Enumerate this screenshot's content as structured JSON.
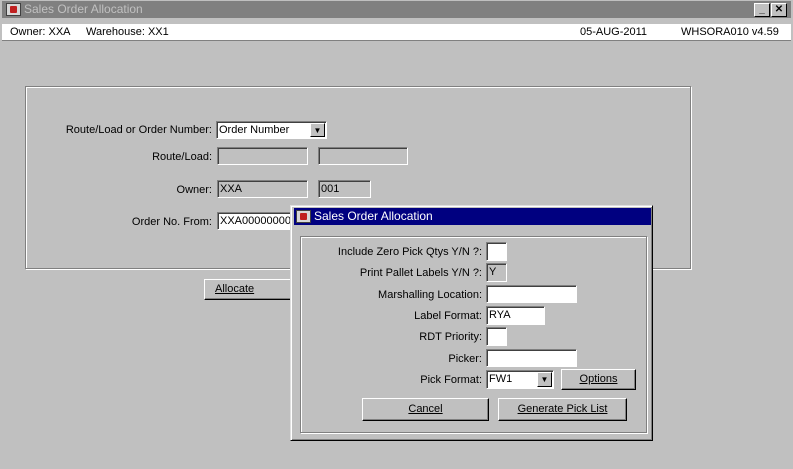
{
  "main_window": {
    "title": "Sales Order Allocation",
    "status": {
      "owner": "Owner:  XXA",
      "warehouse": "Warehouse:  XX1",
      "date": "05-AUG-2011",
      "program": "WHSORA010  v4.59"
    },
    "form": {
      "route_or_order_label": "Route/Load or Order Number:",
      "route_or_order_value": "Order Number",
      "route_load_label": "Route/Load:",
      "route_load_value1": "",
      "route_load_value2": "",
      "owner_label": "Owner:",
      "owner_value": "XXA",
      "owner_code": "001",
      "order_from_label": "Order No. From:",
      "order_from_value": "XXA00000000"
    },
    "allocate_button": "Allocate",
    "minimize_glyph": "_",
    "close_glyph": "✕"
  },
  "dialog": {
    "title": "Sales Order Allocation",
    "fields": {
      "include_zero_label": "Include Zero Pick Qtys Y/N ?:",
      "include_zero_value": "",
      "print_pallet_label": "Print Pallet Labels Y/N ?:",
      "print_pallet_value": "Y",
      "marshalling_label": "Marshalling Location:",
      "marshalling_value": "",
      "label_format_label": "Label Format:",
      "label_format_value": "RYA",
      "rdt_priority_label": "RDT Priority:",
      "rdt_priority_value": "",
      "picker_label": "Picker:",
      "picker_value": "",
      "pick_format_label": "Pick Format:",
      "pick_format_value": "FW1"
    },
    "options_button": "Options",
    "cancel_button": "Cancel",
    "generate_button": "Generate Pick List"
  },
  "icons": {
    "dropdown": "chevron-down-icon",
    "app": "app-icon"
  }
}
